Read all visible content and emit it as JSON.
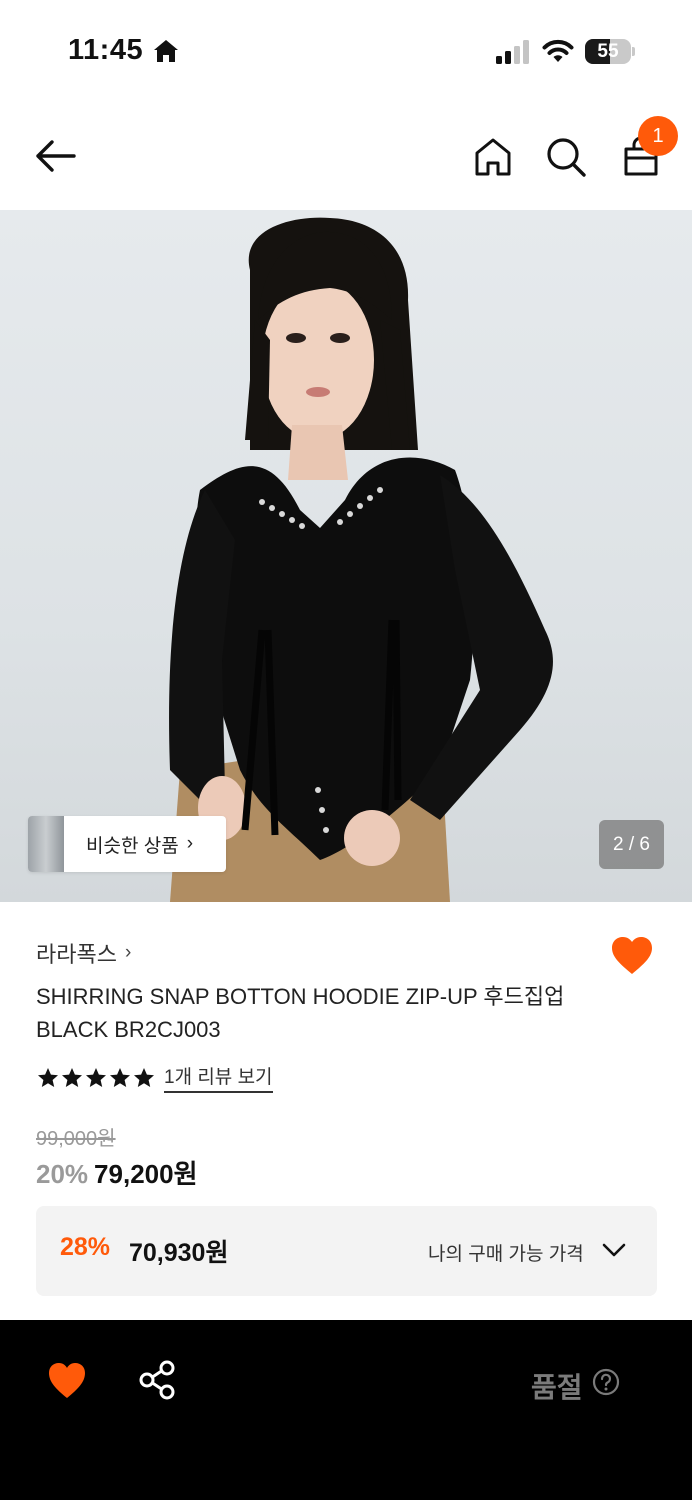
{
  "status_bar": {
    "time": "11:45",
    "battery_percent": 55,
    "battery_label": "55",
    "icons": [
      "home-icon",
      "signal-icon",
      "wifi-icon",
      "battery-icon"
    ]
  },
  "nav": {
    "icons": [
      "back-arrow-icon",
      "home-icon",
      "search-icon",
      "shopping-bag-icon"
    ],
    "cart_count": "1",
    "accent_color": "#ff5a0a"
  },
  "gallery": {
    "similar_products_label": "비슷한 상품",
    "counter": "2 / 6"
  },
  "product": {
    "brand": "라라폭스",
    "title": "SHIRRING SNAP BOTTON HOODIE ZIP-UP 후드집업 BLACK BR2CJ003",
    "rating_stars": 5,
    "review_link": "1개 리뷰 보기",
    "original_price": "99,000원",
    "discount_rate": "20%",
    "sale_price": "79,200원"
  },
  "my_price": {
    "discount_rate": "28%",
    "price": "70,930원",
    "label": "나의 구매 가능 가격"
  },
  "bottom_bar": {
    "status_label": "품절",
    "icons": [
      "heart-icon",
      "share-icon",
      "help-icon"
    ]
  }
}
